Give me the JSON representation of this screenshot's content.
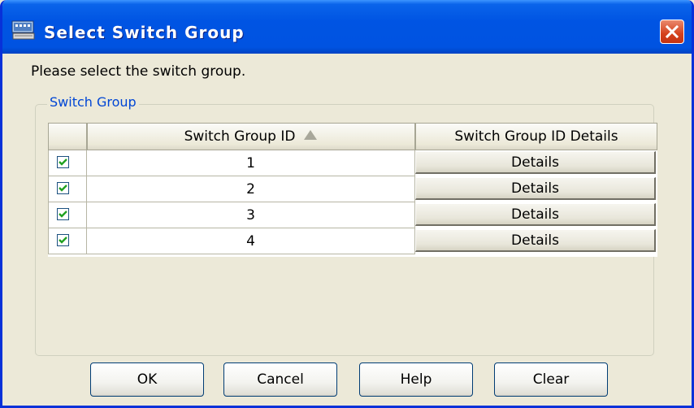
{
  "window": {
    "title": "Select Switch Group"
  },
  "prompt": "Please select the switch group.",
  "group": {
    "legend": "Switch Group",
    "columns": {
      "id_header": "Switch Group ID",
      "details_header": "Switch Group ID Details"
    },
    "rows": [
      {
        "checked": true,
        "id": "1",
        "details_label": "Details"
      },
      {
        "checked": true,
        "id": "2",
        "details_label": "Details"
      },
      {
        "checked": true,
        "id": "3",
        "details_label": "Details"
      },
      {
        "checked": true,
        "id": "4",
        "details_label": "Details"
      }
    ]
  },
  "buttons": {
    "ok": "OK",
    "cancel": "Cancel",
    "help": "Help",
    "clear": "Clear"
  },
  "colors": {
    "titlebar": "#0054e3",
    "accent": "#0046d5",
    "check": "#21a121",
    "close": "#d5411c"
  }
}
